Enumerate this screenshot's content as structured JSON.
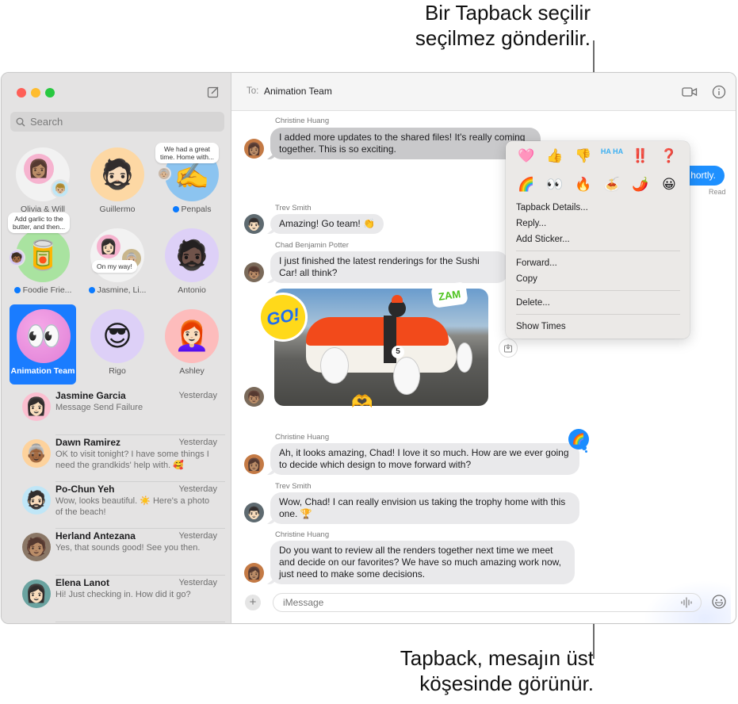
{
  "callouts": {
    "top": [
      "Bir Tapback seçilir",
      "seçilmez gönderilir."
    ],
    "bottom": [
      "Tapback, mesajın üst",
      "köşesinde görünür."
    ]
  },
  "sidebar": {
    "search_placeholder": "Search",
    "pinned": [
      {
        "label": "Olivia & Will",
        "unread": false,
        "icon": "memoji-group"
      },
      {
        "label": "Guillermo",
        "unread": false,
        "icon": "memoji"
      },
      {
        "label": "Penpals",
        "unread": true,
        "icon": "writing-hand",
        "preview": [
          "We had a great",
          "time. Home with..."
        ]
      },
      {
        "label": "Foodie Frie...",
        "unread": true,
        "icon": "tomato-can",
        "preview": [
          "Add garlic to the",
          "butter, and then..."
        ]
      },
      {
        "label": "Jasmine, Li...",
        "unread": true,
        "icon": "memoji-group",
        "preview": [
          "On my way!"
        ]
      },
      {
        "label": "Antonio",
        "unread": false,
        "icon": "memoji"
      },
      {
        "label": "Animation Team",
        "unread": false,
        "selected": true,
        "icon": "eyes"
      },
      {
        "label": "Rigo",
        "unread": false,
        "icon": "memoji"
      },
      {
        "label": "Ashley",
        "unread": false,
        "icon": "memoji"
      }
    ],
    "conversations": [
      {
        "name": "Jasmine Garcia",
        "time": "Yesterday",
        "preview": "Message Send Failure"
      },
      {
        "name": "Dawn Ramirez",
        "time": "Yesterday",
        "preview": "OK to visit tonight? I have some things I need the grandkids' help with. 🥰"
      },
      {
        "name": "Po-Chun Yeh",
        "time": "Yesterday",
        "preview": "Wow, looks beautiful. ☀️ Here's a photo of the beach!"
      },
      {
        "name": "Herland Antezana",
        "time": "Yesterday",
        "preview": "Yes, that sounds good! See you then."
      },
      {
        "name": "Elena Lanot",
        "time": "Yesterday",
        "preview": "Hi! Just checking in. How did it go?"
      }
    ]
  },
  "header": {
    "to_label": "To:",
    "recipient": "Animation Team"
  },
  "messages": [
    {
      "sender": "Christine Huang",
      "text": "I added more updates to the shared files! It's really coming together. This is so exciting."
    },
    {
      "sent_text": "hortly.",
      "status": "Read"
    },
    {
      "sender": "Trev Smith",
      "text": "Amazing! Go team! 👏"
    },
    {
      "sender": "Chad Benjamin Potter",
      "text": "I just finished the latest renderings for the Sushi Car! all think?"
    },
    {
      "sender": "Chad Benjamin Potter",
      "attachment": "sushi-car-photo",
      "stickers": [
        "GO!",
        "ZAM",
        "heart-hands"
      ]
    },
    {
      "sender": "Christine Huang",
      "text": "Ah, it looks amazing, Chad! I love it so much. How are we ever going to decide which design to move forward with?",
      "tapback": "🌈"
    },
    {
      "sender": "Trev Smith",
      "text": "Wow, Chad! I can really envision us taking the trophy home with this one. 🏆"
    },
    {
      "sender": "Christine Huang",
      "text": "Do you want to review all the renders together next time we meet and decide on our favorites? We have so much amazing work now, just need to make some decisions."
    }
  ],
  "context_menu": {
    "tapbacks": [
      "🩷",
      "👍",
      "👎",
      "HA HA",
      "‼️",
      "❓",
      "🌈",
      "👀",
      "🔥",
      "🍝",
      "🌶️",
      "😀"
    ],
    "groups": [
      [
        "Tapback Details...",
        "Reply...",
        "Add Sticker..."
      ],
      [
        "Forward...",
        "Copy"
      ],
      [
        "Delete..."
      ],
      [
        "Show Times"
      ]
    ]
  },
  "composer": {
    "placeholder": "iMessage"
  },
  "colors": {
    "accent": "#1a7cff",
    "sent_bubble": "#1e90ff",
    "received_bubble": "#e9e9eb"
  }
}
